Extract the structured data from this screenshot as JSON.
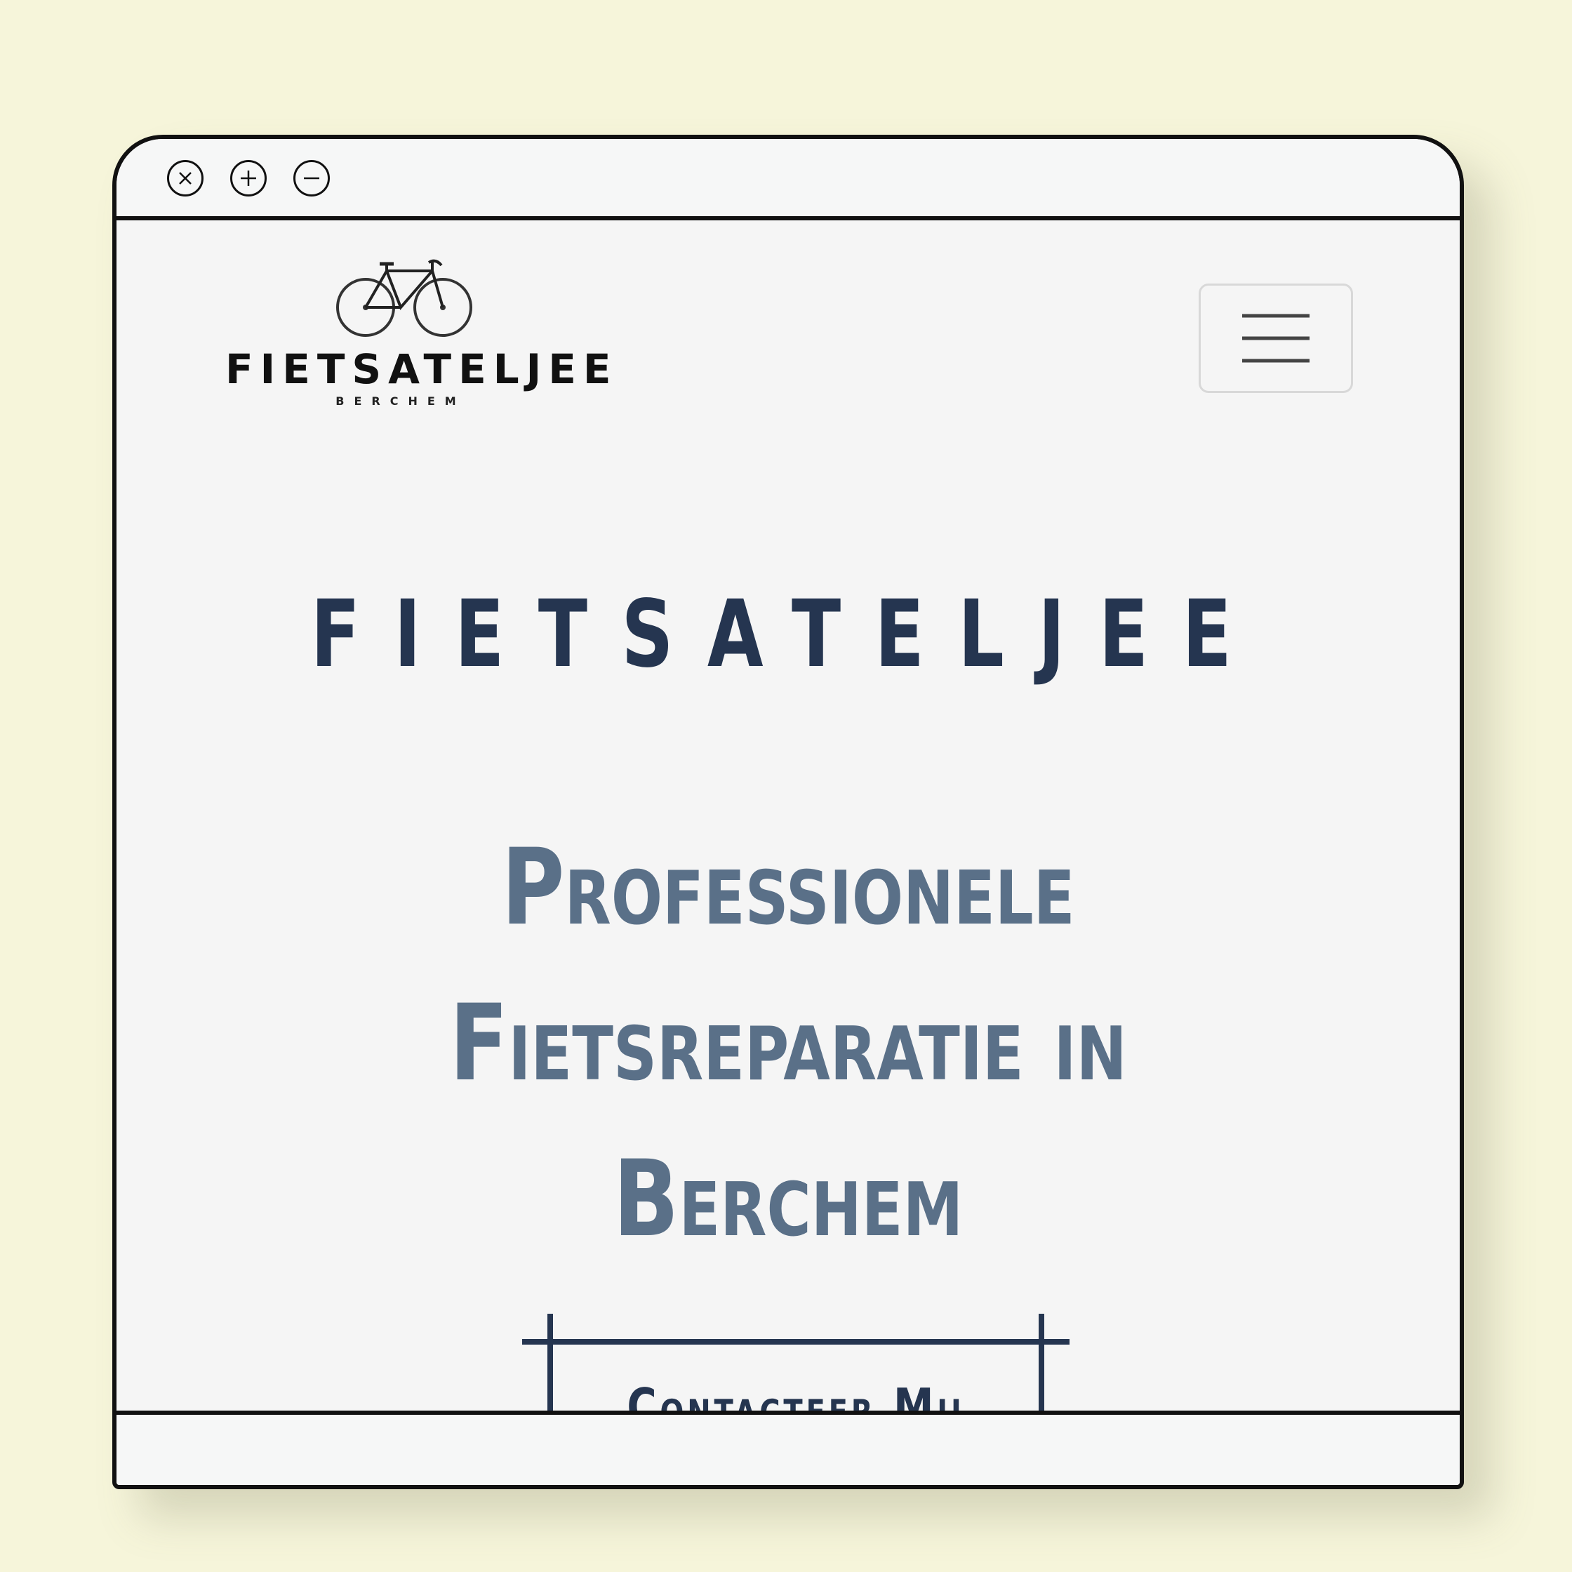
{
  "window": {
    "controls": {
      "close_icon": "close-icon",
      "maximize_icon": "plus-icon",
      "minimize_icon": "minus-icon"
    }
  },
  "header": {
    "logo": {
      "wordmark": "FIETSATELJEE",
      "subtitle": "BERCHEM",
      "icon": "bicycle-icon"
    },
    "menu_icon": "hamburger-menu-icon"
  },
  "hero": {
    "brand": "FIETSATELJEE",
    "headline": "Professionele Fietsreparatie in Berchem",
    "cta_label": "Contacteer Mij"
  },
  "colors": {
    "background": "#f6f5da",
    "page": "#f5f5f5",
    "brand": "#253550",
    "headline": "#5a7088",
    "frame": "#111111"
  }
}
